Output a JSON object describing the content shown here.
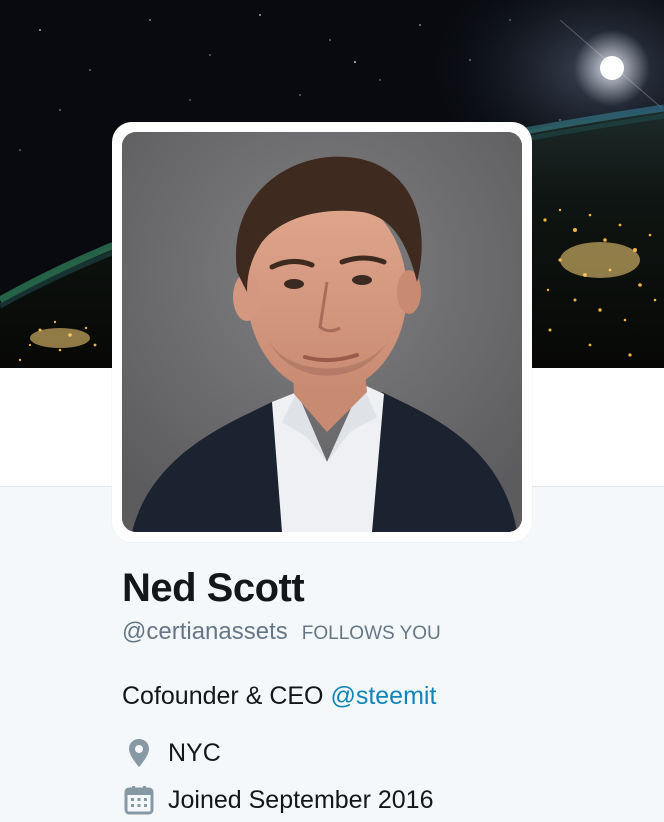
{
  "profile": {
    "name": "Ned Scott",
    "handle": "@certianassets",
    "follows_you": "FOLLOWS YOU",
    "bio_text": "Cofounder & CEO ",
    "bio_link": "@steemit",
    "location": "NYC",
    "joined": "Joined September 2016"
  },
  "icons": {
    "location": "location-pin-icon",
    "calendar": "calendar-icon"
  },
  "colors": {
    "name": "#14171a",
    "secondary_text": "#657786",
    "link": "#0f84b9",
    "page_background": "#f5f8fa",
    "icon": "#8899a6"
  }
}
